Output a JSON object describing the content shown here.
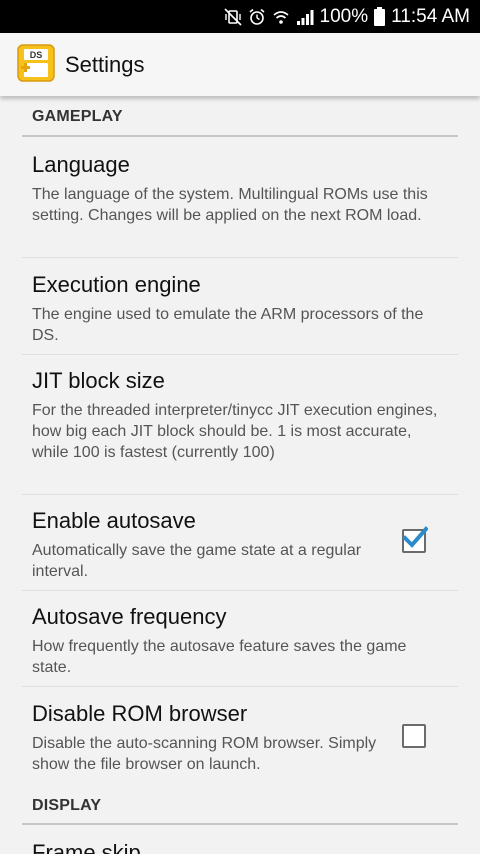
{
  "status_bar": {
    "battery": "100%",
    "time": "11:54 AM",
    "icons": [
      "mute-vibrate-icon",
      "alarm-icon",
      "wifi-icon",
      "signal-icon",
      "battery-icon"
    ]
  },
  "app_bar": {
    "logo_text": "DS",
    "title": "Settings"
  },
  "sections": [
    {
      "header": "GAMEPLAY",
      "items": [
        {
          "title": "Language",
          "summary": "The language of the system. Multilingual ROMs use this setting. Changes will be applied on the next ROM load."
        },
        {
          "title": "Execution engine",
          "summary": "The engine used to emulate the ARM processors of the DS."
        },
        {
          "title": "JIT block size",
          "summary": "For the threaded interpreter/tinycc JIT execution engines, how big each JIT block should be. 1 is most accurate, while 100 is fastest (currently 100)"
        },
        {
          "title": "Enable autosave",
          "summary": "Automatically save the game state at a regular interval.",
          "checked": true
        },
        {
          "title": "Autosave frequency",
          "summary": "How frequently the autosave feature saves the game state."
        },
        {
          "title": "Disable ROM browser",
          "summary": "Disable the auto-scanning ROM browser. Simply show the file browser on launch.",
          "checked": false
        }
      ]
    },
    {
      "header": "DISPLAY",
      "items": [
        {
          "title": "Frame skip"
        }
      ]
    }
  ],
  "colors": {
    "checkbox_check": "#2e8bc9",
    "section_line": "#c8c8c8",
    "background": "#f2f2f2"
  }
}
